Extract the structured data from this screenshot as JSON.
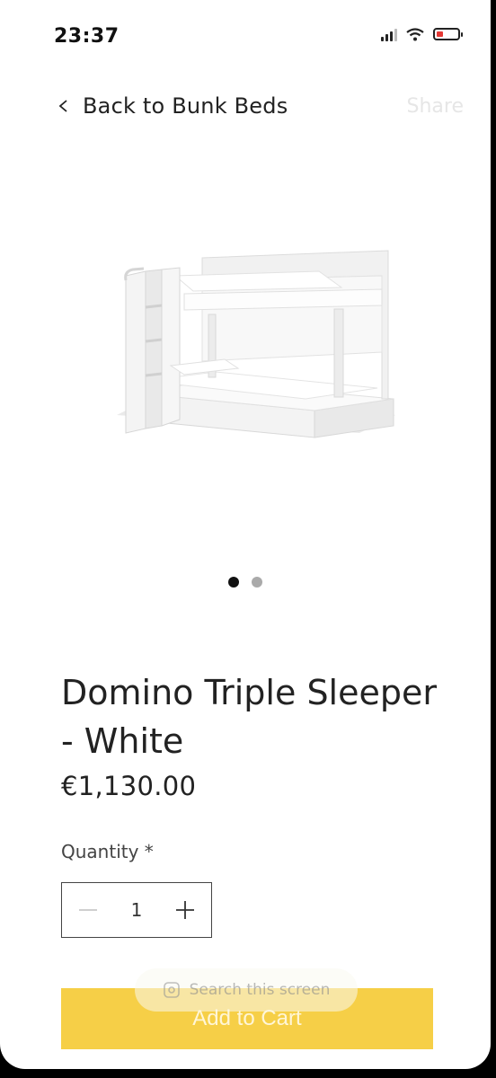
{
  "status_bar": {
    "time": "23:37",
    "battery_color": "#e53935",
    "battery_level": 0.3,
    "signal_bars_active": 3
  },
  "nav": {
    "back_label": "Back to Bunk Beds",
    "share_label": "Share"
  },
  "gallery": {
    "image_icon": "bunk-bed-image",
    "image_count": 2,
    "active_index": 0
  },
  "product": {
    "title": "Domino Triple Sleeper - White",
    "price": "€1,130.00",
    "quantity_label": "Quantity *",
    "quantity_value": "1"
  },
  "actions": {
    "add_to_cart_label": "Add to Cart",
    "add_to_cart_color": "#f6cf47",
    "search_overlay_label": "Search this screen"
  }
}
